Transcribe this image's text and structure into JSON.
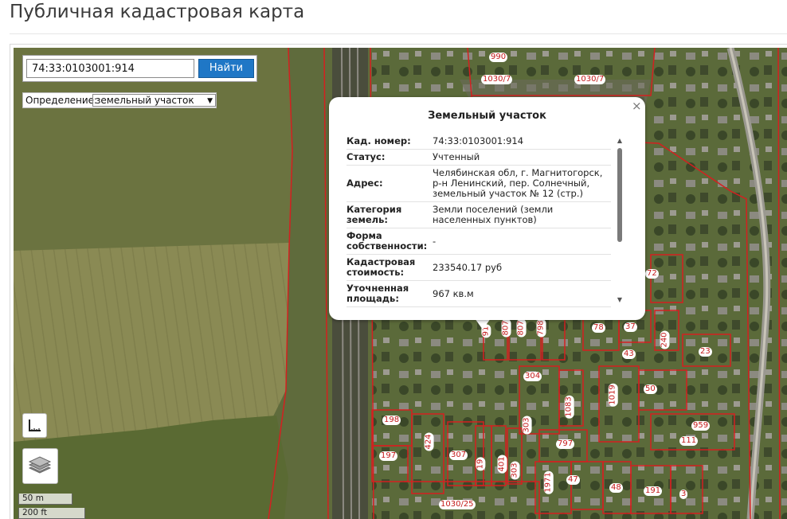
{
  "page": {
    "title": "Публичная кадастровая карта"
  },
  "search": {
    "value": "74:33:0103001:914",
    "button_label": "Найти"
  },
  "definition": {
    "label": "Определение:",
    "selected": "земельный участок"
  },
  "popup": {
    "title": "Земельный участок",
    "close_symbol": "×",
    "rows": [
      {
        "key": "Кад. номер",
        "value": "74:33:0103001:914"
      },
      {
        "key": "Статус",
        "value": "Учтенный"
      },
      {
        "key": "Адрес",
        "value": "Челябинская обл, г. Магнитогорск, р-н Ленинский, пер. Солнечный, земельный участок № 12 (стр.)"
      },
      {
        "key": "Категория земель",
        "value": "Земли поселений (земли населенных пунктов)"
      },
      {
        "key": "Форма собственности",
        "value": "-"
      },
      {
        "key": "Кадастровая стоимость",
        "value": "233540.17 руб"
      },
      {
        "key": "Уточненная площадь",
        "value": "967 кв.м"
      }
    ]
  },
  "scale": {
    "metric": "50 m",
    "imperial": "200 ft"
  },
  "parcels": [
    "990",
    "1030/7",
    "1030/7",
    "72",
    "78",
    "37",
    "240",
    "43",
    "23",
    "91",
    "807",
    "807",
    "798",
    "304",
    "1083",
    "1019",
    "50",
    "198",
    "424",
    "303",
    "797",
    "959",
    "111",
    "197",
    "307",
    "19",
    "401",
    "303",
    "1971",
    "47",
    "48",
    "191",
    "3",
    "1030/25"
  ],
  "icons": {
    "close": "close-icon",
    "measure": "ruler-icon",
    "layers": "layers-icon",
    "scroll_up": "arrow-up-icon",
    "scroll_down": "arrow-down-icon"
  },
  "colors": {
    "accent": "#1f77c6",
    "parcel_border": "#d42020",
    "parcel_label": "#c41a1a"
  }
}
